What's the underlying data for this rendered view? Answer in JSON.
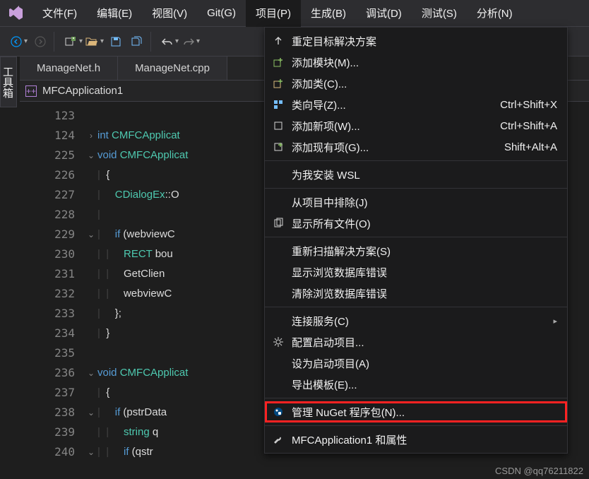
{
  "menubar": {
    "items": [
      {
        "label": "文件(F)"
      },
      {
        "label": "编辑(E)"
      },
      {
        "label": "视图(V)"
      },
      {
        "label": "Git(G)"
      },
      {
        "label": "项目(P)",
        "active": true
      },
      {
        "label": "生成(B)"
      },
      {
        "label": "调试(D)"
      },
      {
        "label": "测试(S)"
      },
      {
        "label": "分析(N)"
      }
    ]
  },
  "sidebar": {
    "toolbox_label": "工具箱"
  },
  "doctabs": {
    "tabs": [
      {
        "label": "ManageNet.h"
      },
      {
        "label": "ManageNet.cpp"
      }
    ]
  },
  "navbar": {
    "scope": "MFCApplication1"
  },
  "code": {
    "lines": [
      {
        "n": 123,
        "fold": "",
        "html": ""
      },
      {
        "n": 124,
        "fold": ">",
        "html": "<span class='kw'>int</span> <span class='tp'>CMFCApplicat</span>"
      },
      {
        "n": 225,
        "fold": "v",
        "html": "<span class='kw'>void</span> <span class='tp'>CMFCApplicat</span>"
      },
      {
        "n": 226,
        "fold": "",
        "html": "<span class='bars'>|  </span>{"
      },
      {
        "n": 227,
        "fold": "",
        "html": "<span class='bars'>|  </span>   <span class='tp'>CDialogEx</span>::O"
      },
      {
        "n": 228,
        "fold": "",
        "html": "<span class='bars'>|  </span>"
      },
      {
        "n": 229,
        "fold": "v",
        "html": "<span class='bars'>|  </span>   <span class='kw'>if</span> (webviewC"
      },
      {
        "n": 230,
        "fold": "",
        "html": "<span class='bars'>|  |  </span>   <span class='tp'>RECT</span> bou"
      },
      {
        "n": 231,
        "fold": "",
        "html": "<span class='bars'>|  |  </span>   GetClien"
      },
      {
        "n": 232,
        "fold": "",
        "html": "<span class='bars'>|  |  </span>   webviewC"
      },
      {
        "n": 233,
        "fold": "",
        "html": "<span class='bars'>|  </span>   };"
      },
      {
        "n": 234,
        "fold": "",
        "html": "<span class='bars'>|  </span>}"
      },
      {
        "n": 235,
        "fold": "",
        "html": ""
      },
      {
        "n": 236,
        "fold": "v",
        "html": "<span class='kw'>void</span> <span class='tp'>CMFCApplicat</span>"
      },
      {
        "n": 237,
        "fold": "",
        "html": "<span class='bars'>|  </span>{"
      },
      {
        "n": 238,
        "fold": "v",
        "html": "<span class='bars'>|  </span>   <span class='kw'>if</span> (pstrData"
      },
      {
        "n": 239,
        "fold": "",
        "html": "<span class='bars'>|  |  </span>   <span class='tp'>string</span> q"
      },
      {
        "n": 240,
        "fold": "v",
        "html": "<span class='bars'>|  |  </span>   <span class='kw'>if</span> (qstr"
      }
    ]
  },
  "menu": {
    "items": [
      {
        "icon": "retarget-icon",
        "svg": "arrow-up",
        "label": "重定目标解决方案"
      },
      {
        "icon": "add-module-icon",
        "svg": "plus-box",
        "label": "添加模块(M)..."
      },
      {
        "icon": "add-class-icon",
        "svg": "plus-class",
        "label": "添加类(C)..."
      },
      {
        "icon": "class-wizard-icon",
        "svg": "wizard",
        "label": "类向导(Z)...",
        "shortcut": "Ctrl+Shift+X"
      },
      {
        "icon": "add-new-item-icon",
        "svg": "new-item",
        "label": "添加新项(W)...",
        "shortcut": "Ctrl+Shift+A"
      },
      {
        "icon": "add-existing-item-icon",
        "svg": "existing-item",
        "label": "添加现有项(G)...",
        "shortcut": "Shift+Alt+A"
      },
      {
        "sep": true
      },
      {
        "icon": "",
        "label": "为我安装 WSL"
      },
      {
        "sep": true
      },
      {
        "icon": "",
        "label": "从项目中排除(J)"
      },
      {
        "icon": "show-all-files-icon",
        "svg": "files",
        "label": "显示所有文件(O)"
      },
      {
        "sep": true
      },
      {
        "icon": "",
        "label": "重新扫描解决方案(S)"
      },
      {
        "icon": "",
        "label": "显示浏览数据库错误"
      },
      {
        "icon": "",
        "label": "清除浏览数据库错误"
      },
      {
        "sep": true
      },
      {
        "icon": "",
        "label": "连接服务(C)",
        "submenu": true
      },
      {
        "icon": "configure-startup-icon",
        "svg": "gear",
        "label": "配置启动项目..."
      },
      {
        "icon": "",
        "label": "设为启动项目(A)"
      },
      {
        "icon": "",
        "label": "导出模板(E)..."
      },
      {
        "sep": true
      },
      {
        "icon": "nuget-icon",
        "svg": "nuget",
        "label": "管理 NuGet 程序包(N)...",
        "highlight": true
      },
      {
        "sep": true
      },
      {
        "icon": "properties-icon",
        "svg": "wrench",
        "label": "MFCApplication1 和属性"
      }
    ]
  },
  "watermark": "CSDN @qq76211822"
}
